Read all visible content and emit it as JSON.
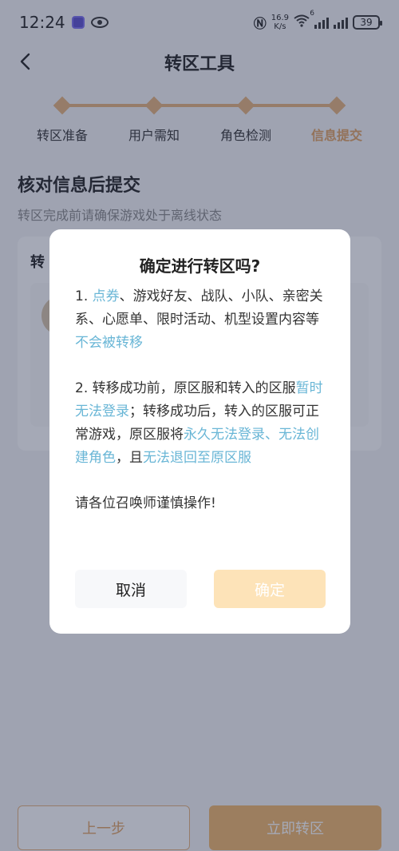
{
  "status": {
    "time": "12:24",
    "speed_value": "16.9",
    "speed_unit": "K/s",
    "wifi_sup": "6",
    "battery": "39"
  },
  "nav": {
    "title": "转区工具"
  },
  "steps": [
    {
      "label": "转区准备"
    },
    {
      "label": "用户需知"
    },
    {
      "label": "角色检测"
    },
    {
      "label": "信息提交"
    }
  ],
  "section": {
    "title": "核对信息后提交",
    "subtitle": "转区完成前请确保游戏处于离线状态"
  },
  "card": {
    "title": "转"
  },
  "dialog": {
    "title": "确定进行转区吗?",
    "p1": {
      "prefix": "1. ",
      "hl1": "点券",
      "mid": "、游戏好友、战队、小队、亲密关系、心愿单、限时活动、机型设置内容等",
      "hl2": "不会被转移"
    },
    "p2": {
      "prefix": "2. 转移成功前，原区服和转入的区服",
      "hl1": "暂时无法登录",
      "mid": "；转移成功后，转入的区服可正常游戏，原区服将",
      "hl2": "永久无法登录、无法创建角色",
      "mid2": "，且",
      "hl3": "无法退回至原区服"
    },
    "p3": "请各位召唤师谨慎操作!",
    "cancel_label": "取消",
    "confirm_label": "确定"
  },
  "bottom": {
    "prev_label": "上一步",
    "submit_label": "立即转区"
  },
  "colors": {
    "accent": "#e6b27a",
    "highlight": "#69b6d6",
    "confirm_bg": "#fde3b8"
  }
}
